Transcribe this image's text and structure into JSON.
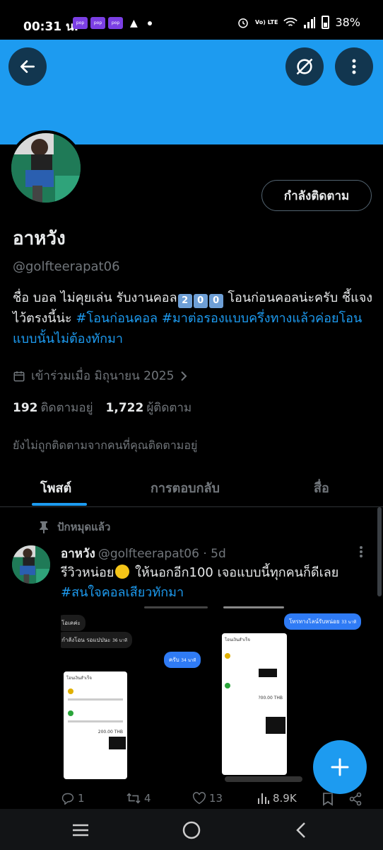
{
  "status_bar": {
    "time": "00:31 น.",
    "app_label": "pop",
    "battery": "38%",
    "volte": "Vo) LTE"
  },
  "profile": {
    "name": "อาหวัง",
    "handle": "@golfteerapat06",
    "follow_button": "กำลังติดตาม",
    "bio_text_1": "ชื่อ บอล ไม่คุยเล่น รับงานคอล",
    "bio_keycaps": [
      "2",
      "0",
      "0"
    ],
    "bio_text_2": " โอนก่อนคอลน่ะครับ ชี้แจงไว้ตรงนี้น่ะ ",
    "bio_tag_1": "#โอนก่อนคอล",
    "bio_tag_2": "#มาต่อรองแบบครึ่งทางแล้วค่อยโอนแบบนั้นไม่ต้องทักมา",
    "joined": "เข้าร่วมเมื่อ มิถุนายน 2025",
    "following_count": "192",
    "following_label": "ติดตามอยู่",
    "followers_count": "1,722",
    "followers_label": "ผู้ติดตาม",
    "not_followed_text": "ยังไม่ถูกติดตามจากคนที่คุณติดตามอยู่"
  },
  "tabs": [
    {
      "label": "โพสต์",
      "active": true
    },
    {
      "label": "การตอบกลับ",
      "active": false
    },
    {
      "label": "สื่อ",
      "active": false
    }
  ],
  "pinned_label": "ปักหมุดแล้ว",
  "post": {
    "name": "อาหวัง",
    "handle": "@golfteerapat06",
    "dot": "·",
    "time": "5d",
    "text_1": "รีวิวหน่อย",
    "text_2": " ให้นอกอีก100 เจอแบบนี้ทุกคนก็ดีเลย",
    "tag": "#สนใจคอลเสียวทักมา",
    "media": {
      "bubble_1": "โอเคค่ะ",
      "bubble_2": "กำลังโอน รอแปปนะ",
      "bubble_2_time": "36 นาที",
      "bubble_3": "ครับ",
      "bubble_3_time": "34 นาที",
      "bubble_4": "โทรทางไลน์รับหน่อย",
      "bubble_4_time": "33 นาที",
      "slip_title": "โอนเงินสำเร็จ",
      "slip_amount": "200.00 THB",
      "slip_amount_2": "?00.00 THB"
    },
    "replies": "1",
    "reposts": "4",
    "likes": "13",
    "views": "8.9K"
  },
  "colors": {
    "accent": "#1d9bf0",
    "background": "#000000",
    "muted": "#71767b",
    "text": "#e7e9ea"
  },
  "icons": [
    "back-arrow-icon",
    "grok-icon",
    "more-vertical-icon",
    "calendar-icon",
    "chevron-right-icon",
    "pin-icon",
    "reply-icon",
    "repost-icon",
    "like-icon",
    "views-icon",
    "bookmark-icon",
    "share-icon",
    "plus-icon",
    "nav-recents-icon",
    "nav-home-icon",
    "nav-back-icon"
  ]
}
